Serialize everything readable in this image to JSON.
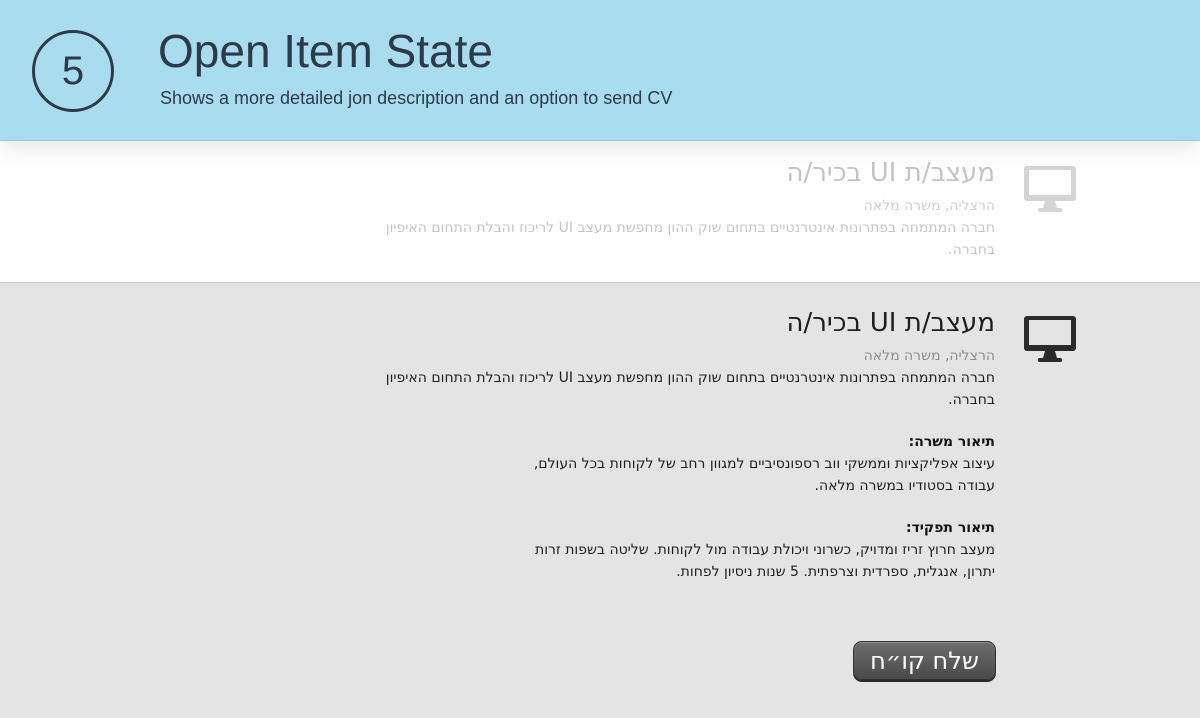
{
  "header": {
    "step_number": "5",
    "title": "Open Item State",
    "subtitle": "Shows a more detailed jon description and an option to send CV",
    "background_color": "#a9dcee",
    "text_color": "#2d3a4a"
  },
  "collapsed_item": {
    "icon": "monitor-icon",
    "title": "מעצב/ת UI בכיר/ה",
    "meta": "הרצליה, משרה מלאה",
    "description": "חברה המתמחה בפתרונות אינטרנטיים בתחום שוק ההון מחפשת מעצב UI לריכוז והבלת התחום האיפיון בחברה."
  },
  "open_item": {
    "icon": "monitor-icon",
    "title": "מעצב/ת UI בכיר/ה",
    "meta": "הרצליה, משרה מלאה",
    "description": "חברה המתמחה בפתרונות אינטרנטיים בתחום שוק ההון מחפשת מעצב UI לריכוז והבלת התחום האיפיון בחברה.",
    "job_description_heading": "תיאור משרה:",
    "job_description_lines": [
      "עיצוב אפליקציות וממשקי ווב רספונסיביים למגוון רחב של לקוחות בכל העולם,",
      "עבודה בסטודיו במשרה מלאה."
    ],
    "role_description_heading": "תיאור תפקיד:",
    "role_description_lines": [
      "מעצב חרוץ זריז ומדויק, כשרוני ויכולת עבודה מול לקוחות. שליטה בשפות זרות",
      "יתרון, אנגלית, ספרדית וצרפתית. 5 שנות ניסיון לפחות."
    ],
    "send_cv_label": "שלח קו״ח",
    "background_color": "#e4e4e4"
  }
}
